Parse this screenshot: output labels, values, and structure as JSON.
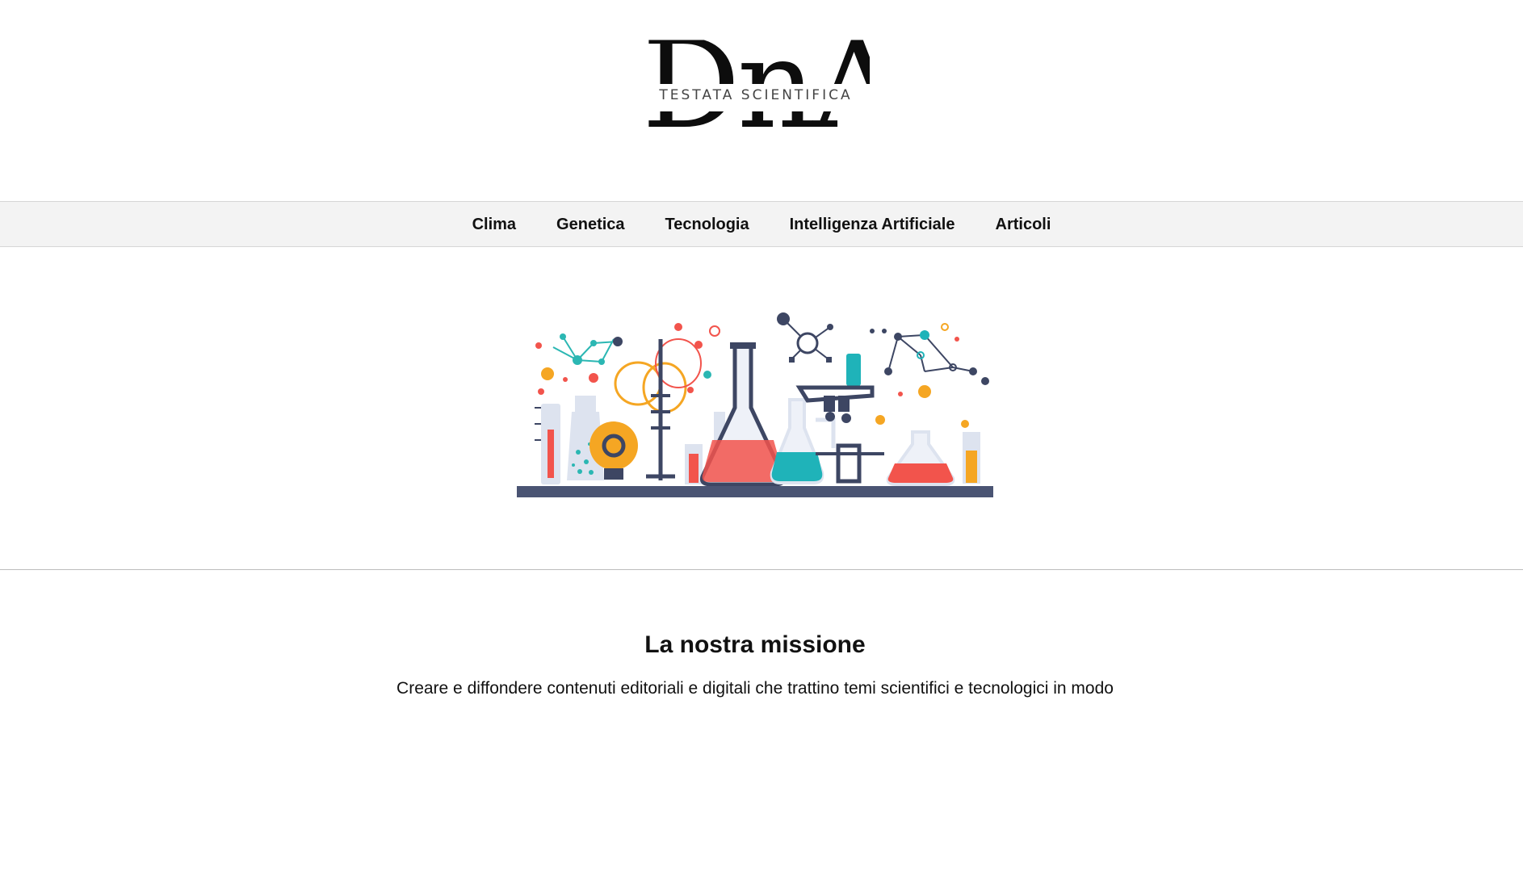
{
  "logo": {
    "letters": "DnA",
    "subtitle": "TESTATA SCIENTIFICA"
  },
  "nav": {
    "items": [
      {
        "label": "Clima"
      },
      {
        "label": "Genetica"
      },
      {
        "label": "Tecnologia"
      },
      {
        "label": "Intelligenza Artificiale"
      },
      {
        "label": "Articoli"
      }
    ]
  },
  "hero": {
    "illustration": "science-lab-illustration",
    "colors": {
      "navy": "#3d4663",
      "red": "#f2544c",
      "teal": "#1fb3b9",
      "orange": "#f5a623",
      "glass": "#dde3ef"
    }
  },
  "mission": {
    "title": "La nostra missione",
    "text": "Creare e diffondere contenuti editoriali e digitali che trattino temi scientifici e tecnologici in modo"
  }
}
